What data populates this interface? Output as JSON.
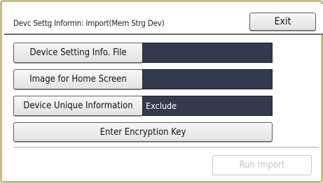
{
  "header": {
    "title": "Devc Settg Informn: Import(Mem Strg Dev)",
    "exit_label": "Exit"
  },
  "rows": [
    {
      "button_label": "Device Setting Info. File",
      "value": ""
    },
    {
      "button_label": "Image for Home Screen",
      "value": ""
    },
    {
      "button_label": "Device Unique Information",
      "value": "Exclude"
    }
  ],
  "encryption_button_label": "Enter Encryption Key",
  "run_import_label": "Run Import",
  "run_import_enabled": false,
  "colors": {
    "frame_border": "#c9bb87",
    "field_background": "#323a4b",
    "disabled_text": "#c4c4c4"
  }
}
